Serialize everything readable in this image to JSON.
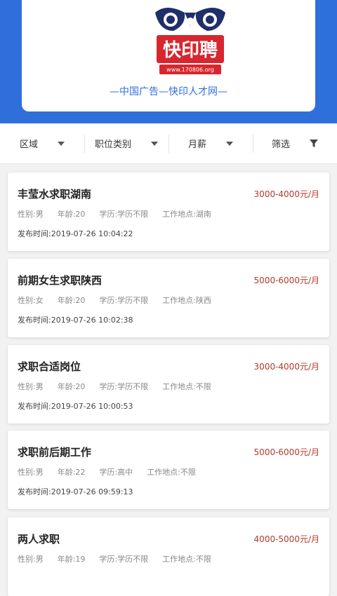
{
  "header": {
    "logo_brand": "快印聘",
    "logo_url_text": "www.170806.org",
    "slogan": "—中国广告—快印人才网—",
    "brand_color": "#2f6fdc"
  },
  "filters": [
    {
      "label": "区域",
      "icon": "caret-down-icon"
    },
    {
      "label": "职位类别",
      "icon": "caret-down-icon"
    },
    {
      "label": "月薪",
      "icon": "caret-down-icon"
    },
    {
      "label": "筛选",
      "icon": "funnel-icon"
    }
  ],
  "jobs": [
    {
      "title": "丰莹水求职湖南",
      "salary": "3000-4000元/月",
      "gender": "性别:男",
      "age": "年龄:20",
      "education": "学历:学历不限",
      "location": "工作地点:湖南",
      "time": "发布时间:2019-07-26 10:04:22"
    },
    {
      "title": "前期女生求职陕西",
      "salary": "5000-6000元/月",
      "gender": "性别:女",
      "age": "年龄:20",
      "education": "学历:学历不限",
      "location": "工作地点:陕西",
      "time": "发布时间:2019-07-26 10:02:38"
    },
    {
      "title": "求职合适岗位",
      "salary": "3000-4000元/月",
      "gender": "性别:男",
      "age": "年龄:20",
      "education": "学历:学历不限",
      "location": "工作地点:不限",
      "time": "发布时间:2019-07-26 10:00:53"
    },
    {
      "title": "求职前后期工作",
      "salary": "5000-6000元/月",
      "gender": "性别:男",
      "age": "年龄:22",
      "education": "学历:高中",
      "location": "工作地点:不限",
      "time": "发布时间:2019-07-26 09:59:13"
    },
    {
      "title": "两人求职",
      "salary": "4000-5000元/月",
      "gender": "性别:男",
      "age": "年龄:19",
      "education": "学历:学历不限",
      "location": "工作地点:不限",
      "time": ""
    }
  ]
}
